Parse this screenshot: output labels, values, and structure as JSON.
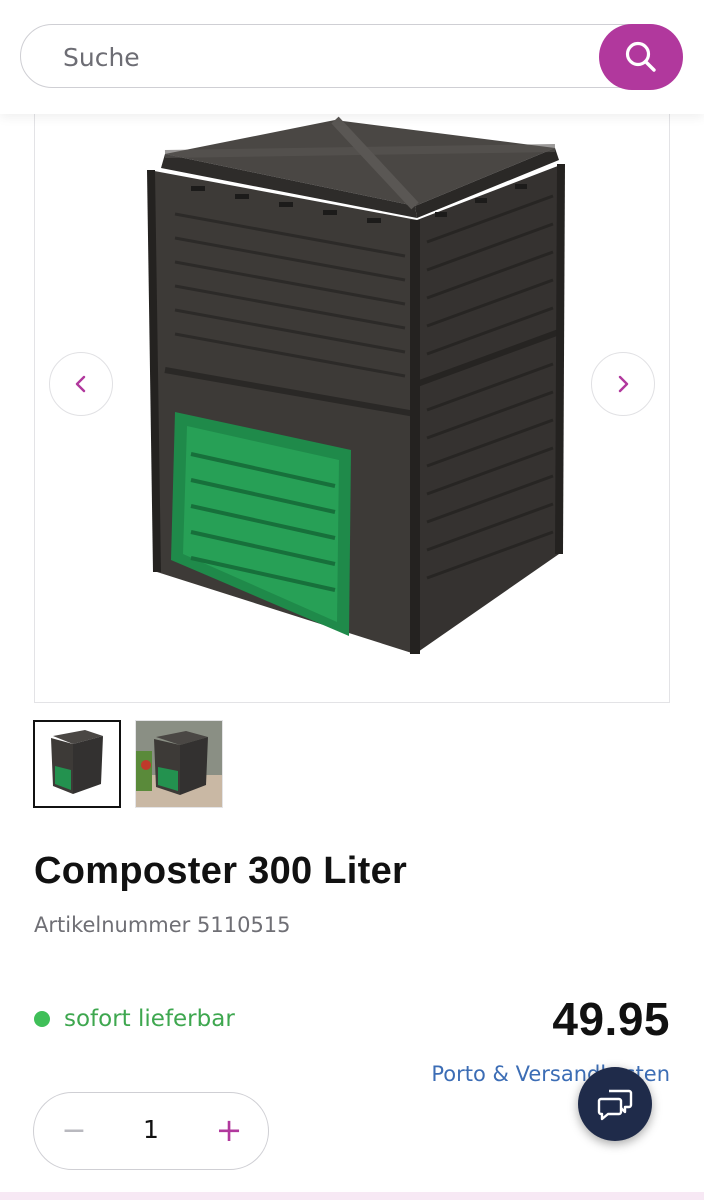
{
  "colors": {
    "accent": "#b1389d",
    "in_stock": "#3fbf58",
    "link": "#3c6db5",
    "chat": "#1f2b4a",
    "product_body": "#3a3734",
    "product_door": "#1f8a4a"
  },
  "search": {
    "placeholder": "Suche",
    "button_icon": "search-icon"
  },
  "gallery": {
    "prev_icon": "chevron-left-icon",
    "next_icon": "chevron-right-icon",
    "thumbnails": [
      {
        "selected": true
      },
      {
        "selected": false
      }
    ]
  },
  "product": {
    "title": "Composter 300 Liter",
    "sku": "Artikelnummer 5110515",
    "availability": "sofort lieferbar",
    "price": "49.95",
    "shipping_link": "Porto & Versandkosten"
  },
  "quantity": {
    "minus": "−",
    "value": "1",
    "plus": "+"
  },
  "chat": {
    "icon": "chat-icon"
  }
}
